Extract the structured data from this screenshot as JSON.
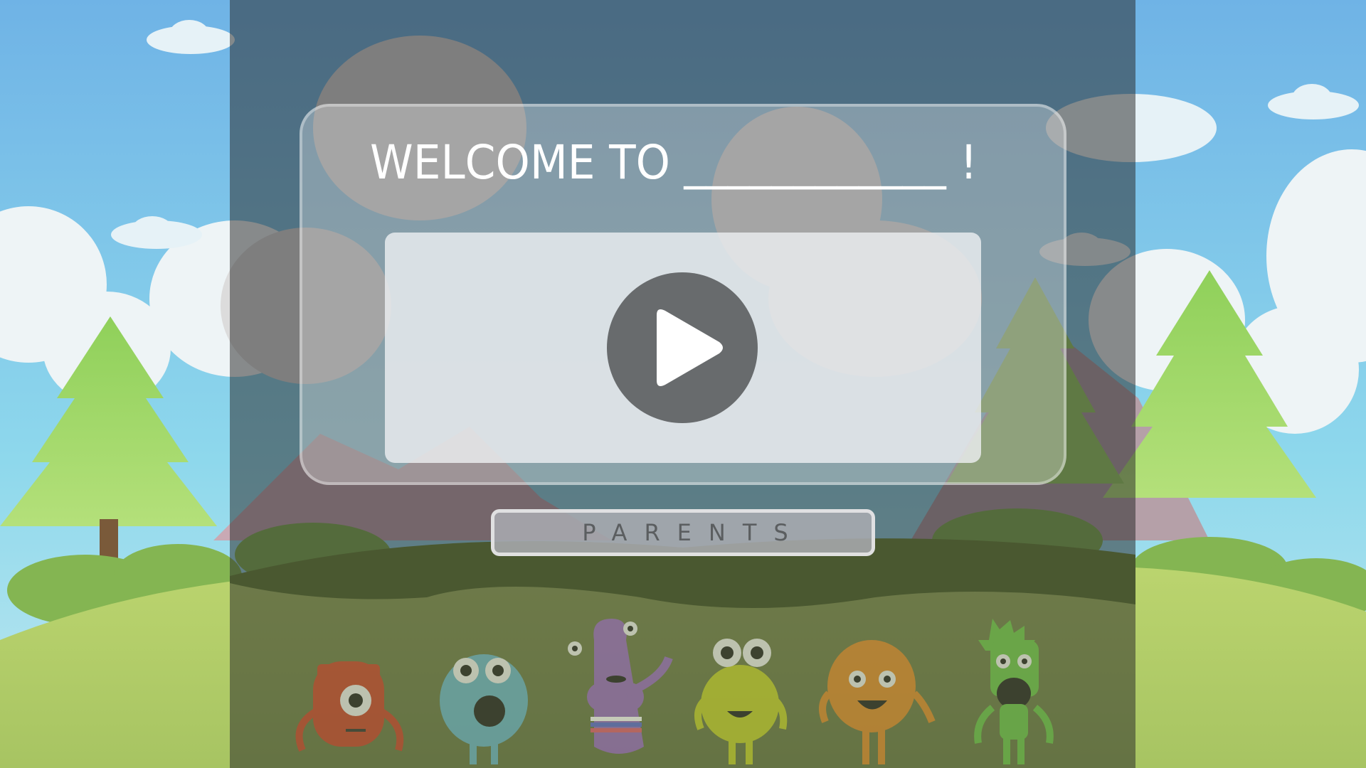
{
  "welcome": {
    "title": "WELCOME TO ____________ !"
  },
  "video": {
    "play_icon": "play-icon"
  },
  "parents_button": {
    "label": "PARENTS"
  },
  "characters": [
    {
      "name": "red-monster",
      "color": "#c9432c"
    },
    {
      "name": "teal-monster",
      "color": "#6ab4c8"
    },
    {
      "name": "purple-monster",
      "color": "#9a6cc0"
    },
    {
      "name": "yellow-monster",
      "color": "#c4cf2a"
    },
    {
      "name": "orange-monster",
      "color": "#df8a2c"
    },
    {
      "name": "green-monster",
      "color": "#6ac24a"
    }
  ],
  "colors": {
    "sky_top": "#6fb3e6",
    "sky_bottom": "#8ed8ec",
    "grass": "#b6d47a",
    "overlay": "#3a3a3a",
    "play_button": "#686b6d"
  }
}
